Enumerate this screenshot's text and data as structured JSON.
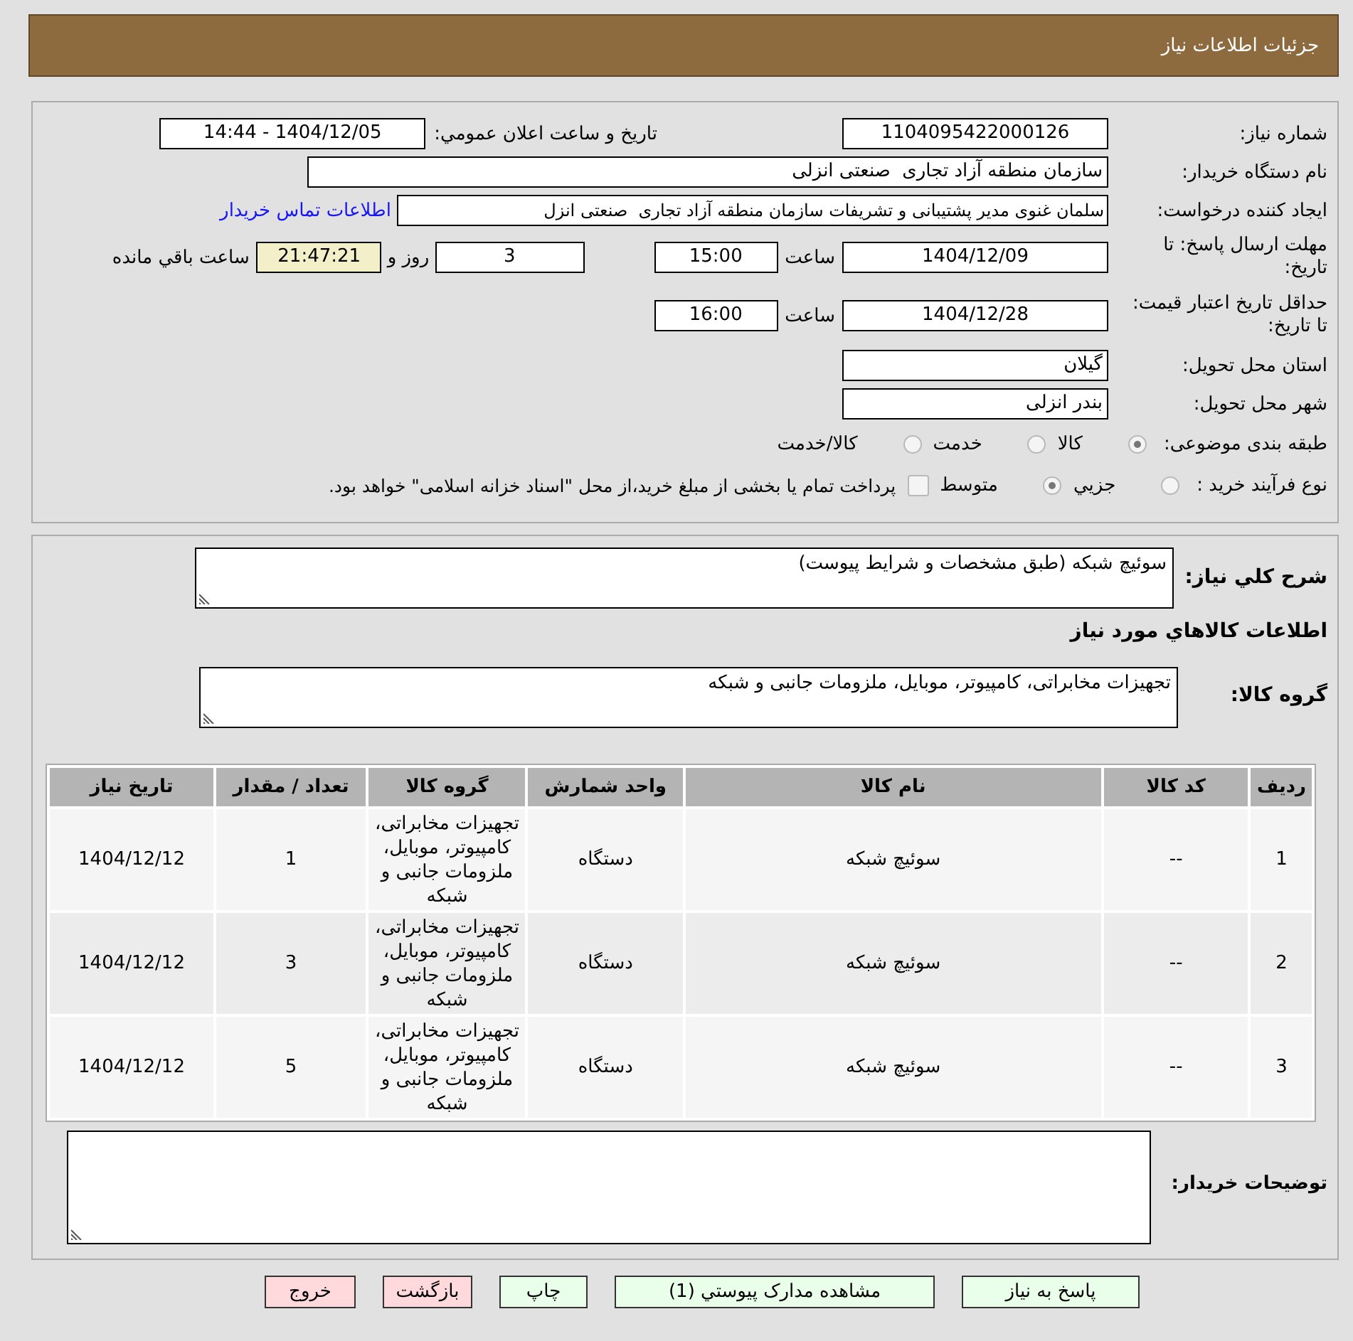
{
  "header": {
    "title": "جزئیات اطلاعات نیاز"
  },
  "need_number": {
    "label": "شماره نیاز:",
    "value": "1104095422000126"
  },
  "announcement": {
    "label": "تاریخ و ساعت اعلان عمومي:",
    "value": "1404/12/05 - 14:44"
  },
  "buyer_org": {
    "label": "نام دستگاه خریدار:",
    "value": "سازمان منطقه آزاد تجاری  صنعتی انزلی"
  },
  "requester": {
    "label": "ایجاد کننده درخواست:",
    "value": "سلمان غنوی مدیر پشتیبانی و تشریفات سازمان منطقه آزاد تجاری  صنعتی انزل",
    "link": "اطلاعات تماس خریدار"
  },
  "reply_deadline": {
    "label": "مهلت ارسال پاسخ: تا تاریخ:",
    "date": "1404/12/09",
    "time_label": "ساعت",
    "time": "15:00",
    "days": "3",
    "days_label": "روز و",
    "remaining": "21:47:21",
    "remaining_label": "ساعت باقي مانده"
  },
  "price_validity": {
    "label": "حداقل تاریخ اعتبار قیمت: تا تاریخ:",
    "date": "1404/12/28",
    "time_label": "ساعت",
    "time": "16:00"
  },
  "province": {
    "label": "استان محل تحویل:",
    "value": "گیلان"
  },
  "city": {
    "label": "شهر محل تحویل:",
    "value": "بندر انزلی"
  },
  "category": {
    "label": "طبقه بندی موضوعی:",
    "options": [
      {
        "label": "کالا",
        "selected": true,
        "disabled": true
      },
      {
        "label": "خدمت",
        "selected": false,
        "disabled": true
      },
      {
        "label": "کالا/خدمت",
        "selected": false,
        "disabled": true
      }
    ]
  },
  "purchase_type": {
    "label": "نوع فرآیند خرید :",
    "options": [
      {
        "label": "جزيي",
        "selected": false,
        "disabled": true
      },
      {
        "label": "متوسط",
        "selected": true,
        "disabled": true
      }
    ],
    "treasury": {
      "label": "پرداخت تمام یا بخشی از مبلغ خرید،از محل \"اسناد خزانه اسلامی\" خواهد بود.",
      "checked": false,
      "disabled": true
    }
  },
  "description": {
    "label": "شرح کلي نیاز:",
    "value": "سوئیچ شبکه (طبق مشخصات و شرایط پیوست)"
  },
  "goods": {
    "title": "اطلاعات کالاهاي مورد نیاز",
    "group_label": "گروه کالا:",
    "group_value": "تجهیزات مخابراتی، کامپیوتر، موبایل، ملزومات جانبی و شبکه"
  },
  "table": {
    "columns": [
      "ردیف",
      "کد کالا",
      "نام کالا",
      "واحد شمارش",
      "گروه کالا",
      "تعداد / مقدار",
      "تاریخ نیاز"
    ],
    "rows": [
      [
        "1",
        "--",
        "سوئیچ شبکه",
        "دستگاه",
        "تجهیزات مخابراتی، کامپیوتر، موبایل، ملزومات جانبی و شبکه",
        "1",
        "1404/12/12"
      ],
      [
        "2",
        "--",
        "سوئیچ شبکه",
        "دستگاه",
        "تجهیزات مخابراتی، کامپیوتر، موبایل، ملزومات جانبی و شبکه",
        "3",
        "1404/12/12"
      ],
      [
        "3",
        "--",
        "سوئیچ شبکه",
        "دستگاه",
        "تجهیزات مخابراتی، کامپیوتر، موبایل، ملزومات جانبی و شبکه",
        "5",
        "1404/12/12"
      ]
    ]
  },
  "buyer_notes": {
    "label": "توضیحات خریدار:"
  },
  "buttons": [
    {
      "label": "پاسخ به نیاز",
      "kind": "action"
    },
    {
      "label": "مشاهده مدارک پیوستي (1)",
      "kind": "action"
    },
    {
      "label": "چاپ",
      "kind": "action"
    },
    {
      "label": "بازگشت",
      "kind": "exit"
    },
    {
      "label": "خروج",
      "kind": "exit"
    }
  ]
}
